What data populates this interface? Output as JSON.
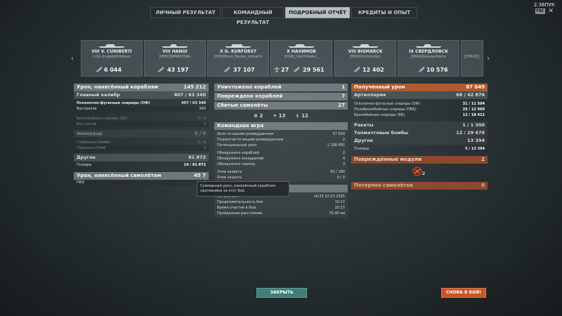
{
  "tabs": [
    "Личный результат",
    "Командный результат",
    "Подробный отчёт",
    "Кредиты и опыт"
  ],
  "active_tab_index": 2,
  "top_right": {
    "badge": "FBC",
    "amount": "2.36ПУК"
  },
  "ships": [
    {
      "name": "VIII V. CUNIBERTI",
      "player": "[-DG-]InglebbVibdeen",
      "damage": "6 044",
      "count": ""
    },
    {
      "name": "VIII HANOI",
      "player": "[MIEO]MNRS534b",
      "damage": "43 197",
      "count": ""
    },
    {
      "name": "X G. KURFÜRST",
      "player": "[OPN]Toms_Pavlov_celvachi",
      "damage": "37 107",
      "count": ""
    },
    {
      "name": "X НАХИМОВ",
      "player": "[KGB]_DarthVader_",
      "damage": "29 561",
      "count": "27"
    },
    {
      "name": "VIII BISMARCK",
      "player": "[BRDO]simondich",
      "damage": "12 402",
      "count": ""
    },
    {
      "name": "IX СВЕРДЛОВСК",
      "player": "[MIRA]NanayeHamo",
      "damage": "10 576",
      "count": ""
    },
    {
      "name": "",
      "player": "[STRUD]",
      "damage": "",
      "count": ""
    }
  ],
  "left_panel": {
    "dealt": {
      "label": "Урон, нанесённый кораблям",
      "value": "145 212"
    },
    "main_battery": {
      "label": "Главный калибр",
      "value": "407 / 63 340"
    },
    "he_shells": {
      "label": "Осколочно-фугасные снаряды (ОФ)",
      "value": "407 / 63 340"
    },
    "shots": {
      "label": "Выстрелов",
      "value": "990"
    },
    "ap_shells": {
      "label": "Бронебойные снаряды (ББ)",
      "value": "0 / 0"
    },
    "ap_shots": {
      "label": "Выстрелов",
      "value": "0"
    },
    "aviation": {
      "label": "Авиаудар",
      "value": "0 / 0"
    },
    "depth": {
      "label": "Глубинные бомбы",
      "value": "5 / 9"
    },
    "depth_dropped": {
      "label": "Сброшено бомб",
      "value": "0"
    },
    "other": {
      "label": "Другое",
      "value": "81 872"
    },
    "fires": {
      "label": "Пожары",
      "value": "14 / 81 872"
    },
    "planes_dmg": {
      "label": "Урон, нанесённый самолётам",
      "value": "45 7"
    },
    "aa": {
      "label": "ПВО",
      "value": "4"
    }
  },
  "mid_panel": {
    "destroyed": {
      "label": "Уничтожено кораблей",
      "value": "1"
    },
    "damaged": {
      "label": "Повреждено кораблей",
      "value": "7"
    },
    "planes_shot": {
      "label": "Сбитые самолёты",
      "value": "27"
    },
    "icon_counts": [
      "2",
      "13",
      "12"
    ],
    "team_header": "Командная игра",
    "team_rows": [
      {
        "label": "Урон по вашим разведданным",
        "value": "57 620"
      },
      {
        "label": "Поджогов по вашим разведданным",
        "value": "2"
      },
      {
        "label": "Потенциальный урон",
        "value": "1 198 891"
      },
      {
        "label": "Обнаружено кораблей",
        "value": "2"
      },
      {
        "label": "Обнаружено эскадрилий",
        "value": "4"
      },
      {
        "label": "Обнаружено торпед",
        "value": "3"
      },
      {
        "label": "Очки захвата",
        "value": "60 / 180"
      },
      {
        "label": "Очки защиты",
        "value": "0 / 3"
      }
    ],
    "battle_rows": [
      {
        "label": "Начало боя",
        "value": "16:25  12.07.2025"
      },
      {
        "label": "Продолжительность боя",
        "value": "15:17"
      },
      {
        "label": "Время участия в бою",
        "value": "15:17"
      },
      {
        "label": "Пройденное расстояние",
        "value": "75.40 км"
      }
    ]
  },
  "right_panel": {
    "received": {
      "label": "Полученный урон",
      "value": "87 049"
    },
    "artillery": {
      "label": "Артиллерия",
      "value": "68 / 42 876"
    },
    "he": {
      "label": "Осколочно-фугасные снаряды (ОФ)",
      "value": "31 / 11 504"
    },
    "sap": {
      "label": "Полубронебойные снаряды (ПББ)",
      "value": "25 / 12 960"
    },
    "ap": {
      "label": "Бронебойные снаряды (ББ)",
      "value": "12 / 18 412"
    },
    "rockets": {
      "label": "Ракеты",
      "value": "1 / 1 300"
    },
    "bombs": {
      "label": "Топмачтовые бомбы",
      "value": "12 / 29 479"
    },
    "other": {
      "label": "Другое",
      "value": "13 394"
    },
    "fires": {
      "label": "Пожары",
      "value": "5 / 13 394"
    },
    "modules": {
      "label": "Повреждённые модули",
      "value": "2"
    },
    "module_count": "2",
    "planes_lost": {
      "label": "Потеряно самолётов",
      "value": "0"
    }
  },
  "tooltip": "Суммарный урон, нанесённый кораблям противника за этот бой.",
  "buttons": {
    "close": "Закрыть",
    "again": "Снова в бой!"
  },
  "colors": {
    "orange": "#b05a2e",
    "teal": "#3f7f78",
    "battle": "#c9532a"
  }
}
